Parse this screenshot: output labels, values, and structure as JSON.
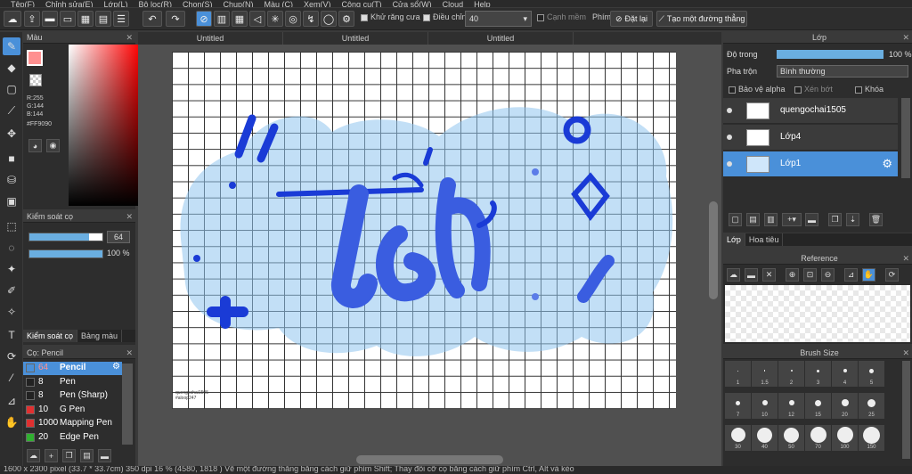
{
  "menu": [
    "Tệp(F)",
    "Chỉnh sửa(E)",
    "Lớp(L)",
    "Bộ lọc(R)",
    "Chọn(S)",
    "Chụp(N)",
    "Màu (C)",
    "Xem(V)",
    "Công cụ(T)",
    "Cửa sổ(W)",
    "Cloud",
    "Help"
  ],
  "toolbar": {
    "antialias_label": "Khử răng cưa",
    "adjust_label": "Điều chỉnh",
    "adjust_value": "40",
    "sharp_edge_label": "Cạnh mềm",
    "keys_label": "Phím",
    "reset_label": "Đặt lại",
    "straight_line_label": "Tạo một đường thẳng"
  },
  "color_panel": {
    "title": "Màu",
    "r": "R:255",
    "g": "G:144",
    "b": "B:144",
    "hex": "#FF9090",
    "fg_color": "#ff9090"
  },
  "brush_control": {
    "title": "Kiểm soát cọ",
    "size_value": "64",
    "opacity_value": "100 %",
    "size_fraction": 0.82,
    "opacity_fraction": 1.0
  },
  "left_tabs": [
    "Kiểm soát cọ",
    "Bảng màu"
  ],
  "brush_panel": {
    "title": "Cọ: Pencil",
    "items": [
      {
        "size": "64",
        "name": "Pencil",
        "color": "#4a90d9"
      },
      {
        "size": "8",
        "name": "Pen",
        "color": "#222222"
      },
      {
        "size": "8",
        "name": "Pen (Sharp)",
        "color": "#222222"
      },
      {
        "size": "10",
        "name": "G Pen",
        "color": "#e03030"
      },
      {
        "size": "1000",
        "name": "Mapping Pen",
        "color": "#e03030"
      },
      {
        "size": "20",
        "name": "Edge Pen",
        "color": "#30b030"
      }
    ]
  },
  "doc_tabs": [
    "Untitled",
    "Untitled",
    "Untitled"
  ],
  "canvas": {
    "signature_line1": "quengochai1505",
    "signature_line2": "#aloop247"
  },
  "layer_panel": {
    "title": "Lớp",
    "opacity_label": "Độ trong",
    "opacity_value": "100 %",
    "blend_label": "Pha trộn",
    "blend_value": "Bình thường",
    "protect_alpha": "Bảo vệ alpha",
    "clipping": "Xén bớt",
    "lock": "Khóa",
    "layers": [
      {
        "name": "quengochai1505"
      },
      {
        "name": "Lớp4"
      },
      {
        "name": "Lớp1"
      }
    ],
    "tabs": [
      "Lớp",
      "Hoa tiêu"
    ]
  },
  "reference_panel": {
    "title": "Reference"
  },
  "brush_size_panel": {
    "title": "Brush Size",
    "sizes": [
      "1",
      "1.5",
      "2",
      "3",
      "4",
      "5",
      "7",
      "10",
      "12",
      "15",
      "20",
      "25",
      "30",
      "40",
      "50",
      "70",
      "100",
      "150"
    ]
  },
  "status": {
    "text": "1600 x 2300 pixel  (33.7 * 33.7cm)  350 dpi  16 %  (4580, 1818 )  Vẽ một đường thẳng bằng cách giữ phím Shift; Thay đổi cỡ cọ bằng cách giữ phím Ctrl, Alt và kéo"
  }
}
